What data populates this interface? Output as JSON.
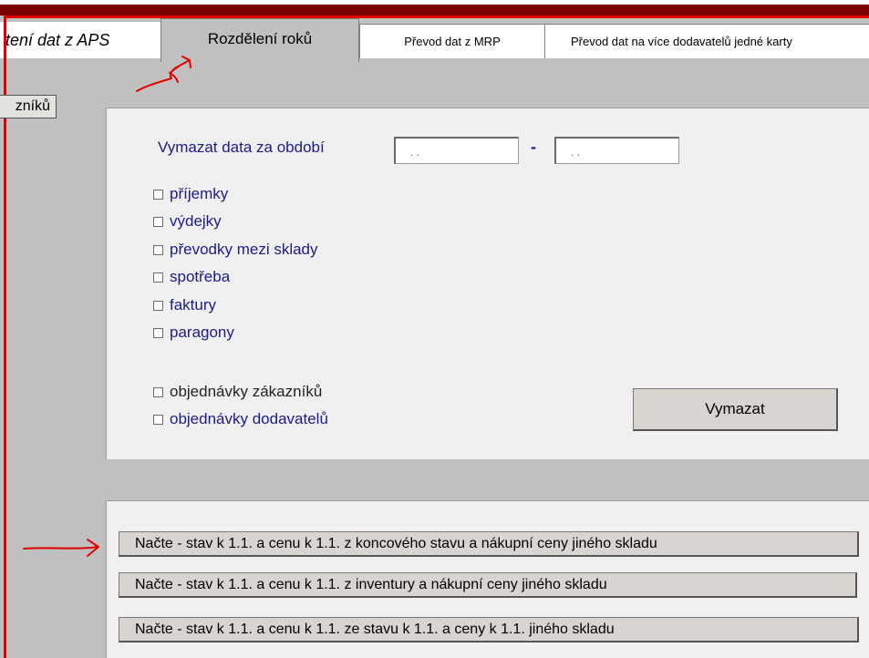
{
  "colors": {
    "window_bg": "#c0c0c0",
    "panel_bg": "#f0f0f0",
    "label_blue": "#1b1b8a",
    "annotation_red": "#e00000",
    "title_bar": "#7a0000"
  },
  "tabs": [
    {
      "label": "tení dat z APS"
    },
    {
      "label": "Rozdělení roků",
      "active": true
    },
    {
      "label": "Převod dat z MRP"
    },
    {
      "label": "Převod dat na více dodavatelů jedné karty"
    }
  ],
  "side_button": {
    "label": "zníků"
  },
  "delete_panel": {
    "period_label": "Vymazat data za období",
    "date_from": {
      "value": ". ."
    },
    "date_separator": "-",
    "date_to": {
      "value": ". ."
    },
    "checkboxes": [
      {
        "label": "příjemky",
        "checked": false
      },
      {
        "label": "výdejky",
        "checked": false
      },
      {
        "label": "převodky mezi sklady",
        "checked": false
      },
      {
        "label": "spotřeba",
        "checked": false
      },
      {
        "label": "faktury",
        "checked": false
      },
      {
        "label": "paragony",
        "checked": false
      }
    ],
    "order_checkboxes": [
      {
        "label": "objednávky zákazníků",
        "checked": false
      },
      {
        "label": "objednávky dodavatelů",
        "checked": false
      }
    ],
    "delete_button": "Vymazat"
  },
  "load_panel": {
    "buttons": [
      "Načte - stav k 1.1. a cenu k 1.1. z  koncového stavu a nákupní ceny jiného skladu",
      "Načte - stav k 1.1. a cenu k 1.1. z  inventury a nákupní ceny jiného skladu",
      "Načte - stav k 1.1. a cenu k 1.1. ze stavu k 1.1. a ceny k 1.1. jiného skladu"
    ]
  }
}
